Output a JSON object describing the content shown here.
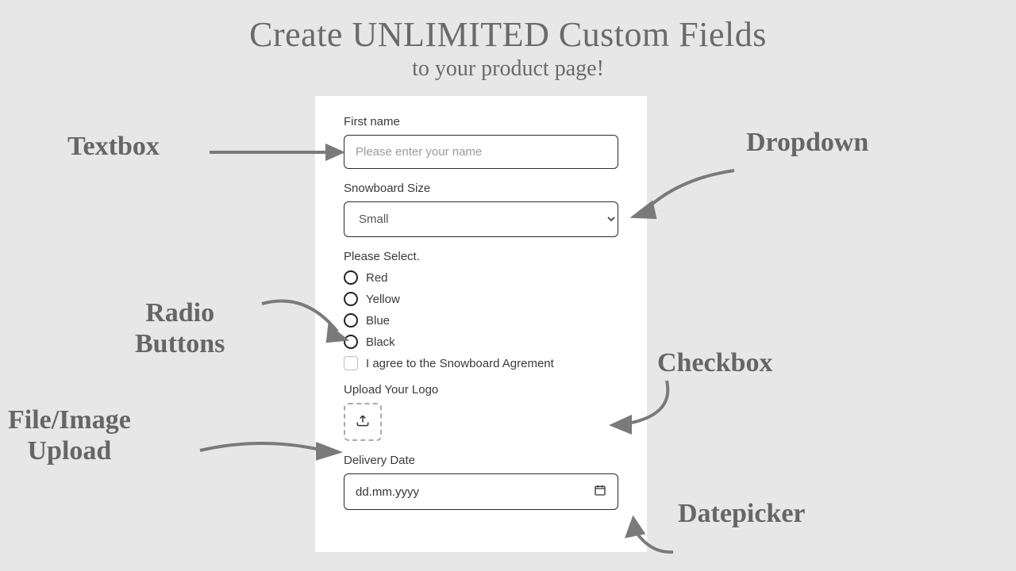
{
  "heading": {
    "title": "Create UNLIMITED Custom Fields",
    "subtitle": "to your product page!"
  },
  "form": {
    "first_name": {
      "label": "First name",
      "placeholder": "Please enter your name"
    },
    "size": {
      "label": "Snowboard Size",
      "selected": "Small"
    },
    "radios": {
      "label": "Please Select.",
      "options": {
        "0": "Red",
        "1": "Yellow",
        "2": "Blue",
        "3": "Black"
      }
    },
    "checkbox": {
      "label": "I agree to the Snowboard Agrement"
    },
    "upload": {
      "label": "Upload Your Logo"
    },
    "date": {
      "label": "Delivery Date",
      "placeholder": "dd.mm.yyyy"
    }
  },
  "annotations": {
    "textbox": "Textbox",
    "dropdown": "Dropdown",
    "radio_l1": "Radio",
    "radio_l2": "Buttons",
    "checkbox": "Checkbox",
    "upload_l1": "File/Image",
    "upload_l2": "Upload",
    "date": "Datepicker"
  }
}
